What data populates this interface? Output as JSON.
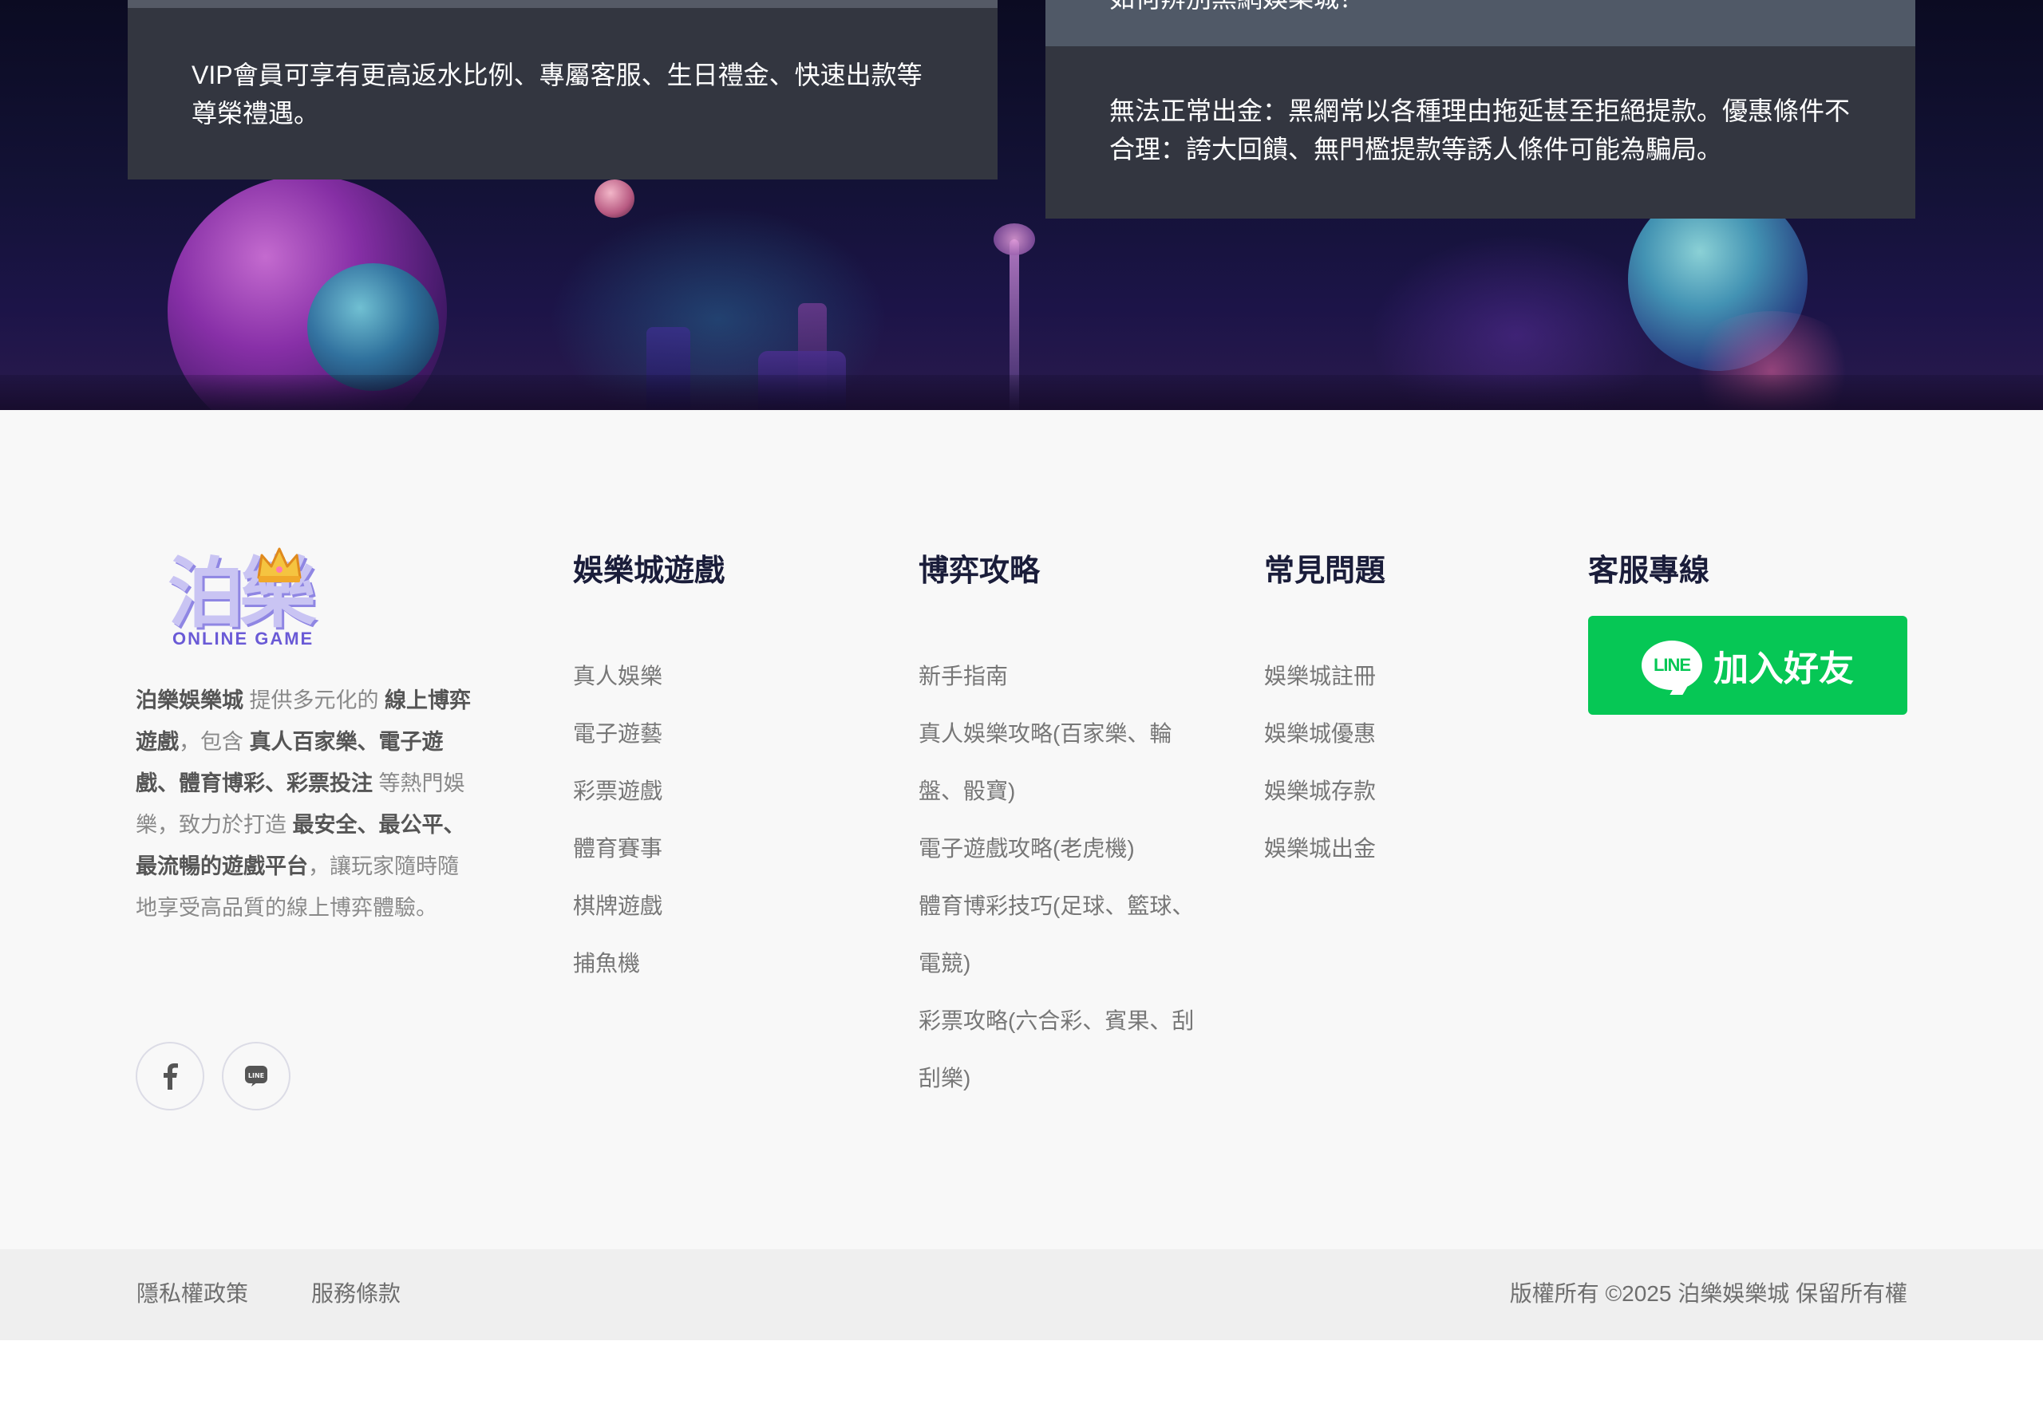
{
  "hero": {
    "left_card": {
      "text": "VIP會員可享有更高返水比例、專屬客服、生日禮金、快速出款等尊榮禮遇。"
    },
    "right_card": {
      "heading": "如何辨別黑網娛樂城？",
      "text": "無法正常出金：黑網常以各種理由拖延甚至拒絕提款。優惠條件不合理：誇大回饋、無門檻提款等誘人條件可能為騙局。"
    }
  },
  "brand": {
    "logo_mark": "泊樂",
    "logo_sub": "ONLINE GAME",
    "desc": [
      {
        "t": "泊樂娛樂城",
        "b": true
      },
      {
        "t": " 提供多元化的 ",
        "b": false
      },
      {
        "t": "線上博弈遊戲",
        "b": true
      },
      {
        "t": "，包含 ",
        "b": false
      },
      {
        "t": "真人百家樂、電子遊戲、體育博彩、彩票投注",
        "b": true
      },
      {
        "t": " 等熱門娛樂，致力於打造 ",
        "b": false
      },
      {
        "t": "最安全、最公平、最流暢的遊戲平台",
        "b": true
      },
      {
        "t": "，讓玩家隨時隨地享受高品質的線上博弈體驗。",
        "b": false
      }
    ],
    "socials": [
      {
        "icon": "facebook-icon"
      },
      {
        "icon": "line-icon"
      }
    ]
  },
  "columns": {
    "games": {
      "title": "娛樂城遊戲",
      "items": [
        "真人娛樂",
        "電子遊藝",
        "彩票遊戲",
        "體育賽事",
        "棋牌遊戲",
        "捕魚機"
      ]
    },
    "guide": {
      "title": "博弈攻略",
      "items": [
        "新手指南",
        "真人娛樂攻略(百家樂、輪盤、骰寶)",
        "電子遊戲攻略(老虎機)",
        "體育博彩技巧(足球、籃球、電競)",
        "彩票攻略(六合彩、賓果、刮刮樂)"
      ]
    },
    "faq": {
      "title": "常見問題",
      "items": [
        "娛樂城註冊",
        "娛樂城優惠",
        "娛樂城存款",
        "娛樂城出金"
      ]
    },
    "cs": {
      "title": "客服專線",
      "line_logo": "LINE",
      "line_button": "加入好友"
    }
  },
  "bottom": {
    "privacy": "隱私權政策",
    "terms": "服務條款",
    "copyright": "版權所有 ©2025 泊樂娛樂城 保留所有權"
  },
  "colors": {
    "line_green": "#06c755",
    "heading_navy": "#1a1d3a",
    "card_bg": "#333640"
  }
}
